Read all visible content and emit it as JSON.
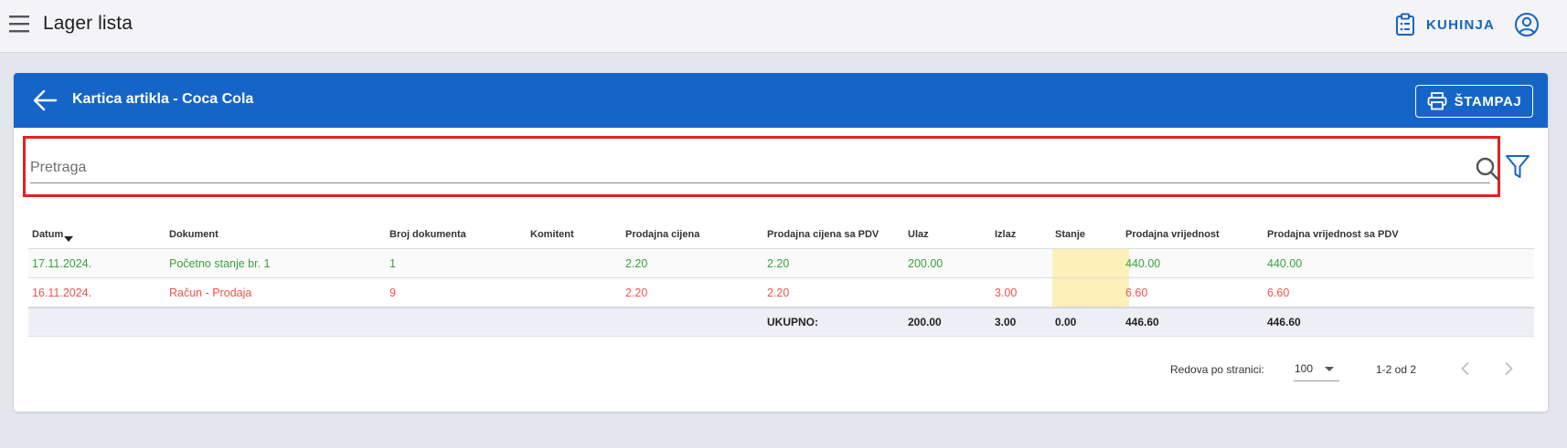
{
  "appbar": {
    "title": "Lager lista",
    "kitchen_label": "KUHINJA"
  },
  "card": {
    "title": "Kartica artikla - Coca Cola",
    "print_label": "ŠTAMPAJ"
  },
  "search": {
    "placeholder": "Pretraga",
    "value": ""
  },
  "table": {
    "columns": [
      "Datum",
      "Dokument",
      "Broj dokumenta",
      "Komitent",
      "Prodajna cijena",
      "Prodajna cijena sa PDV",
      "Ulaz",
      "Izlaz",
      "Stanje",
      "Prodajna vrijednost",
      "Prodajna vrijednost sa PDV"
    ],
    "sorted_column": "Datum",
    "rows": [
      {
        "status_color": "#3aa03a",
        "datum": "17.11.2024.",
        "dokument": "Početno stanje br. 1",
        "broj": "1",
        "komitent": "",
        "cijena": "2.20",
        "cijena_pdv": "2.20",
        "ulaz": "200.00",
        "izlaz": "",
        "stanje": "",
        "vrijednost": "440.00",
        "vrijednost_pdv": "440.00"
      },
      {
        "status_color": "#ef5350",
        "datum": "16.11.2024.",
        "dokument": "Račun - Prodaja",
        "broj": "9",
        "komitent": "",
        "cijena": "2.20",
        "cijena_pdv": "2.20",
        "ulaz": "",
        "izlaz": "3.00",
        "stanje": "",
        "vrijednost": "6.60",
        "vrijednost_pdv": "6.60"
      }
    ],
    "totals": {
      "label": "UKUPNO:",
      "ulaz": "200.00",
      "izlaz": "3.00",
      "stanje": "0.00",
      "vrijednost": "446.60",
      "vrijednost_pdv": "446.60"
    },
    "stanje_highlight_color": "#fdf0b8"
  },
  "pagination": {
    "rows_per_page_label": "Redova po stranici:",
    "rows_per_page_value": "100",
    "range_label": "1-2 od 2"
  },
  "colors": {
    "primary": "#1565c8",
    "search_highlight": "#e52020"
  },
  "icons": [
    "menu-icon",
    "clipboard-icon",
    "account-circle-icon",
    "arrow-left-icon",
    "printer-icon",
    "search-icon",
    "filter-icon",
    "chevron-left-icon",
    "chevron-right-icon"
  ]
}
